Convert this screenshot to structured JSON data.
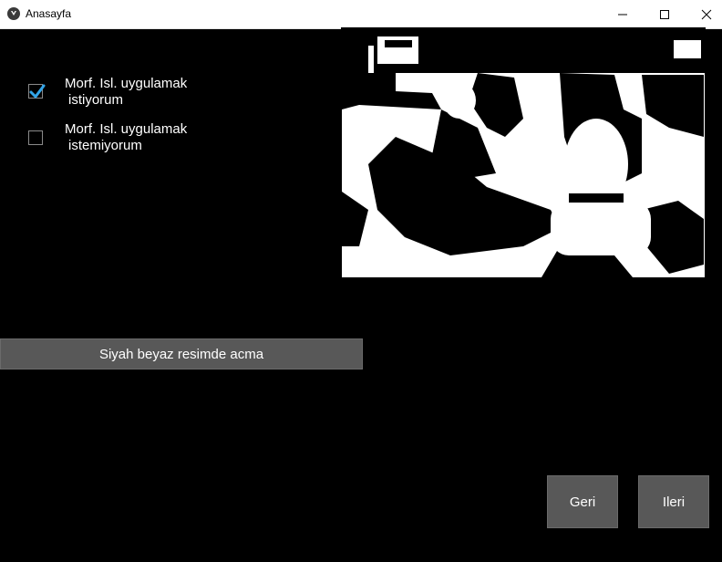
{
  "window": {
    "title": "Anasayfa",
    "icon": "kivy-app-icon",
    "controls": [
      "minimize-icon",
      "maximize-icon",
      "close-icon"
    ]
  },
  "options": [
    {
      "line1": "Morf. Isl. uygulamak",
      "line2": "istiyorum",
      "checked": true
    },
    {
      "line1": "Morf. Isl. uygulamak",
      "line2": "istemiyorum",
      "checked": false
    }
  ],
  "preview": {
    "description_icon": "black-white-image"
  },
  "buttons": {
    "bw": "Siyah beyaz resimde acma",
    "back": "Geri",
    "next": "Ileri"
  },
  "colors": {
    "accent": "#33a5e8",
    "button_bg": "#585858",
    "background": "#000000"
  }
}
